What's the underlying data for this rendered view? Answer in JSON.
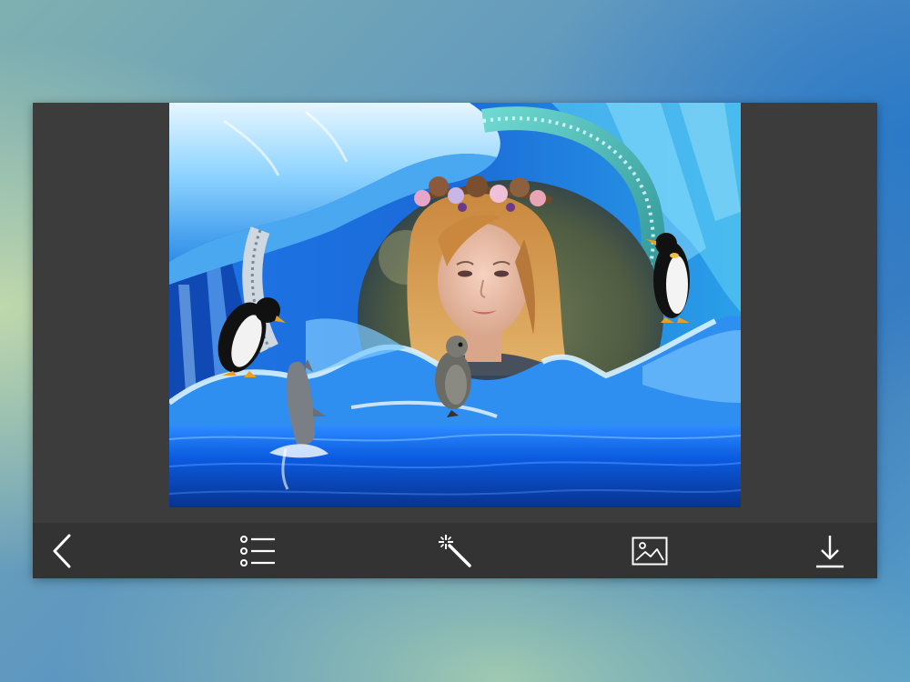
{
  "app": {
    "screen": "photo-frame-editor"
  },
  "canvas": {
    "frame_theme": "ice-cave-penguins-dolphin",
    "photo_subject": "woman-with-flower-crown"
  },
  "toolbar": {
    "items": [
      {
        "name": "back-button",
        "icon": "chevron-left-icon"
      },
      {
        "name": "frames-list-button",
        "icon": "list-icon"
      },
      {
        "name": "effects-button",
        "icon": "magic-wand-icon"
      },
      {
        "name": "gallery-button",
        "icon": "image-icon"
      },
      {
        "name": "save-button",
        "icon": "download-icon"
      }
    ]
  },
  "colors": {
    "panel": "#3c3c3c",
    "toolbar": "#333333",
    "icon": "#ffffff",
    "ice": "#3aa8ff",
    "water": "#0a47b8"
  }
}
